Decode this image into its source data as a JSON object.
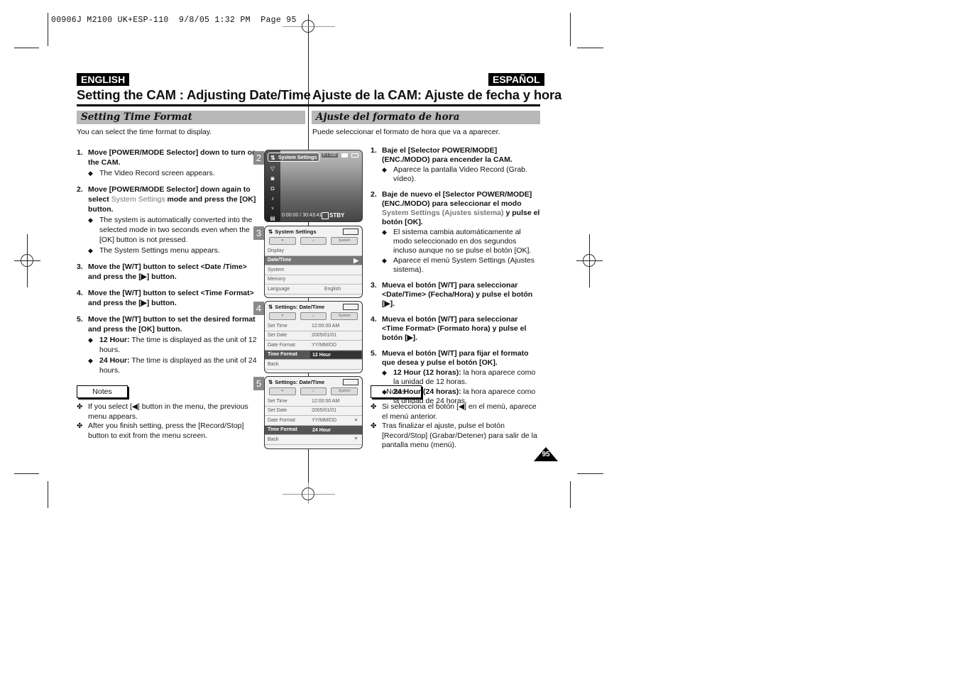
{
  "print_slug": "00906J M2100 UK+ESP-110  9/8/05 1:32 PM  Page 95",
  "english": {
    "lang_label": "ENGLISH",
    "title": "Setting the CAM : Adjusting Date/Time",
    "section": "Setting Time Format",
    "intro": "You can select the time format to display.",
    "steps": [
      {
        "num": "1.",
        "text": "Move [POWER/MODE Selector] down to turn on the CAM.",
        "subs": [
          "The Video Record screen appears."
        ]
      },
      {
        "num": "2.",
        "text_a": "Move [POWER/MODE Selector] down again to select ",
        "text_gray": "System Settings",
        "text_b": " mode and press the [OK] button.",
        "subs": [
          "The system is automatically converted into the selected mode in two seconds even when the [OK] button is not pressed.",
          "The System Settings menu appears."
        ]
      },
      {
        "num": "3.",
        "text": "Move the [W/T] button to select <Date /Time> and press the [▶] button."
      },
      {
        "num": "4.",
        "text": "Move the [W/T] button to select <Time Format> and press the [▶] button."
      },
      {
        "num": "5.",
        "text": "Move the [W/T] button to set the desired format and press the [OK] button.",
        "subs_bold": [
          {
            "bold": "12 Hour:",
            "text": " The time is displayed as the unit of 12 hours."
          },
          {
            "bold": "24 Hour:",
            "text": " The time is displayed as the unit of 24 hours."
          }
        ]
      }
    ],
    "notes_label": "Notes",
    "notes": [
      "If you select [◀] button in the menu, the previous menu appears.",
      "After you finish setting, press the [Record/Stop] button to exit from the menu screen."
    ]
  },
  "espanol": {
    "lang_label": "ESPAÑOL",
    "title": "Ajuste de la CAM: Ajuste de fecha y  hora",
    "section": "Ajuste del formato de hora",
    "intro": "Puede seleccionar el formato de hora que va a aparecer.",
    "steps": [
      {
        "num": "1.",
        "text": "Baje el [Selector POWER/MODE] (ENC./MODO) para encender la CAM.",
        "subs": [
          "Aparece la pantalla Video Record (Grab. vídeo)."
        ]
      },
      {
        "num": "2.",
        "text_a": "Baje de nuevo el [Selector POWER/MODE] (ENC./MODO) para seleccionar el modo ",
        "text_gray": "System Settings (Ajustes sistema)",
        "text_b": " y pulse el botón [OK].",
        "subs": [
          "El sistema cambia automáticamente al modo seleccionado en dos segundos incluso aunque no se pulse el botón [OK].",
          "Aparece el menú System Settings (Ajustes sistema)."
        ]
      },
      {
        "num": "3.",
        "text": "Mueva el botón [W/T] para seleccionar <Date/Time> (Fecha/Hora) y pulse el botón [▶]."
      },
      {
        "num": "4.",
        "text": "Mueva el botón [W/T] para seleccionar <Time Format> (Formato hora) y pulse el botón [▶]."
      },
      {
        "num": "5.",
        "text": "Mueva el botón [W/T] para fijar el formato que desea y pulse el botón [OK].",
        "subs_bold": [
          {
            "bold": "12 Hour (12 horas):",
            "text": " la hora aparece como la unidad de 12 horas."
          },
          {
            "bold": "24 Hour (24 horas):",
            "text": " la hora aparece como la unidad de 24 horas."
          }
        ]
      }
    ],
    "notes_label": "Notas",
    "notes": [
      "Si selecciona el botón [◀] en el menú, aparece el menú anterior.",
      "Tras finalizar el ajuste, pulse el botón [Record/Stop] (Grabar/Detener) para salir de la pantalla menu (menú)."
    ]
  },
  "screens": {
    "s2": {
      "num": "2",
      "menu_label": "System Settings",
      "counter": "F / 720",
      "timecode": "0:00:00 / 30:43:41",
      "status": "STBY",
      "side_icons": [
        "down-arrow-icon",
        "movie-camera-icon",
        "photo-camera-icon",
        "music-note-icon",
        "microphone-icon",
        "file-icon"
      ]
    },
    "s3": {
      "num": "3",
      "title": "System Settings",
      "tabs": [
        "✦",
        "⌂",
        "System"
      ],
      "rows": [
        {
          "label": "Display",
          "value": ""
        },
        {
          "label": "Date/Time",
          "value": "",
          "selected": true
        },
        {
          "label": "System",
          "value": ""
        },
        {
          "label": "Memory",
          "value": ""
        },
        {
          "label": "Language",
          "value": "English"
        }
      ]
    },
    "s4": {
      "num": "4",
      "title": "Settings: Date/Time",
      "tabs": [
        "✦",
        "⌂",
        "System"
      ],
      "rows": [
        {
          "label": "Set Time",
          "value": "12:00:00 AM"
        },
        {
          "label": "Set Date",
          "value": "2005/01/01"
        },
        {
          "label": "Date Format",
          "value": "YY/MM/DD"
        },
        {
          "label": "Time Format",
          "value": "12 Hour",
          "selected": true
        },
        {
          "label": "Back",
          "value": ""
        }
      ]
    },
    "s5": {
      "num": "5",
      "title": "Settings: Date/Time",
      "tabs": [
        "✦",
        "⌂",
        "System"
      ],
      "rows": [
        {
          "label": "Set Time",
          "value": "12:00:00 AM"
        },
        {
          "label": "Set Date",
          "value": "2005/01/01"
        },
        {
          "label": "Date Format",
          "value": "YY/MM/DD"
        },
        {
          "label": "Time Format",
          "value": "24 Hour",
          "selected": true
        },
        {
          "label": "Back",
          "value": ""
        }
      ]
    }
  },
  "page_number": "95"
}
